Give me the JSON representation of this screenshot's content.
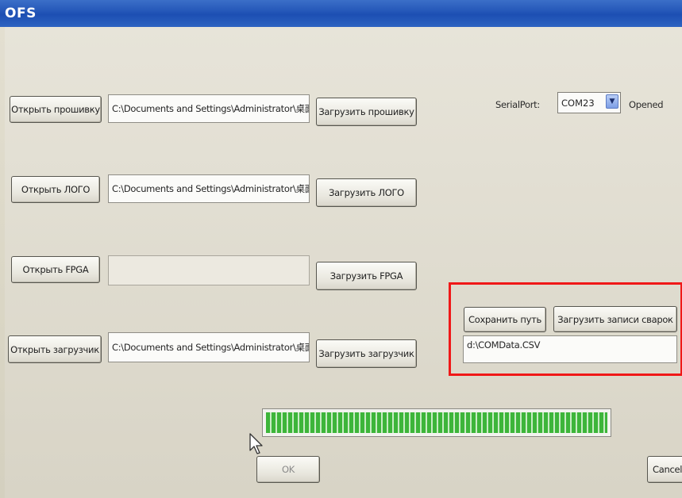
{
  "window": {
    "title": "OFS"
  },
  "firmware": {
    "open_label": "Открыть прошивку",
    "path": "C:\\Documents and Settings\\Administrator\\桌面",
    "load_label": "Загрузить прошивку"
  },
  "logo": {
    "open_label": "Открыть ЛОГО",
    "path": "C:\\Documents and Settings\\Administrator\\桌面",
    "load_label": "Загрузить ЛОГО"
  },
  "fpga": {
    "open_label": "Открыть FPGA",
    "path": "",
    "load_label": "Загрузить FPGA"
  },
  "loader": {
    "open_label": "Открыть загрузчик",
    "path": "C:\\Documents and Settings\\Administrator\\桌面",
    "load_label": "Загрузить загрузчик"
  },
  "serial": {
    "label": "SerialPort:",
    "selected": "COM23",
    "status": "Opened"
  },
  "weld_records": {
    "save_path_label": "Сохранить путь",
    "load_records_label": "Загрузить записи сварок",
    "path": "d:\\COMData.CSV"
  },
  "progress": {
    "percent": 100
  },
  "footer": {
    "ok_label": "OK",
    "cancel_label": "Cancel"
  },
  "colors": {
    "highlight_frame": "#f01818",
    "progress_fill": "#3db53a",
    "title_bar": "#1d4fb3"
  },
  "icons": {
    "dropdown": "chevron-down-icon",
    "cursor": "mouse-pointer-icon"
  }
}
